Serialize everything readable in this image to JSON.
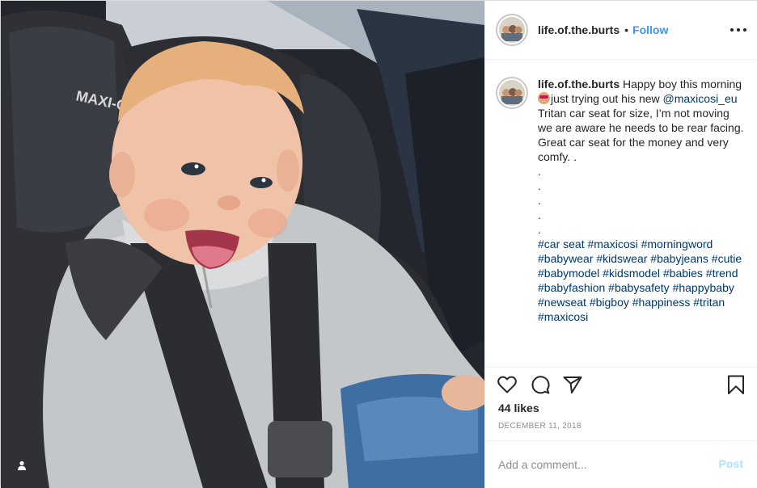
{
  "post": {
    "username": "life.of.the.burts",
    "follow_label": "Follow",
    "separator": "•",
    "caption": {
      "username": "life.of.the.burts",
      "line1_text": " Happy boy this morning ",
      "line1_after_emoji": "just trying out his new ",
      "mention": "@maxicosi_eu",
      "after_mention": " Tritan car seat for size, I’m not moving we are aware he needs to be rear facing.\nGreat car seat for the money and very comfy. .\n.\n.\n.\n.\n.\n",
      "hashtags": "#car seat #maxicosi #morningword #babywear #kidswear #babyjeans #cutie #babymodel #kidsmodel #babies #trend #babyfashion #babysafety #happybaby #newseat #bigboy #happiness #tritan #maxicosi",
      "emoji_name": "smiling-face-with-sunglasses-emoji"
    },
    "likes_text": "44 likes",
    "date_text": "DECEMBER 11, 2018",
    "comment_placeholder": "Add a comment...",
    "post_button_label": "Post"
  },
  "photo": {
    "seat_brand_text": "MAXI-C",
    "description_icon": "user-tag-icon"
  },
  "icons": {
    "like": "heart-icon",
    "comment": "comment-bubble-icon",
    "share": "paper-plane-icon",
    "save": "bookmark-icon",
    "more": "more-options-icon"
  },
  "colors": {
    "link_blue": "#3897f0",
    "hashtag": "#00376b",
    "muted": "#8e8e8e",
    "post_disabled": "#b2dffc"
  }
}
